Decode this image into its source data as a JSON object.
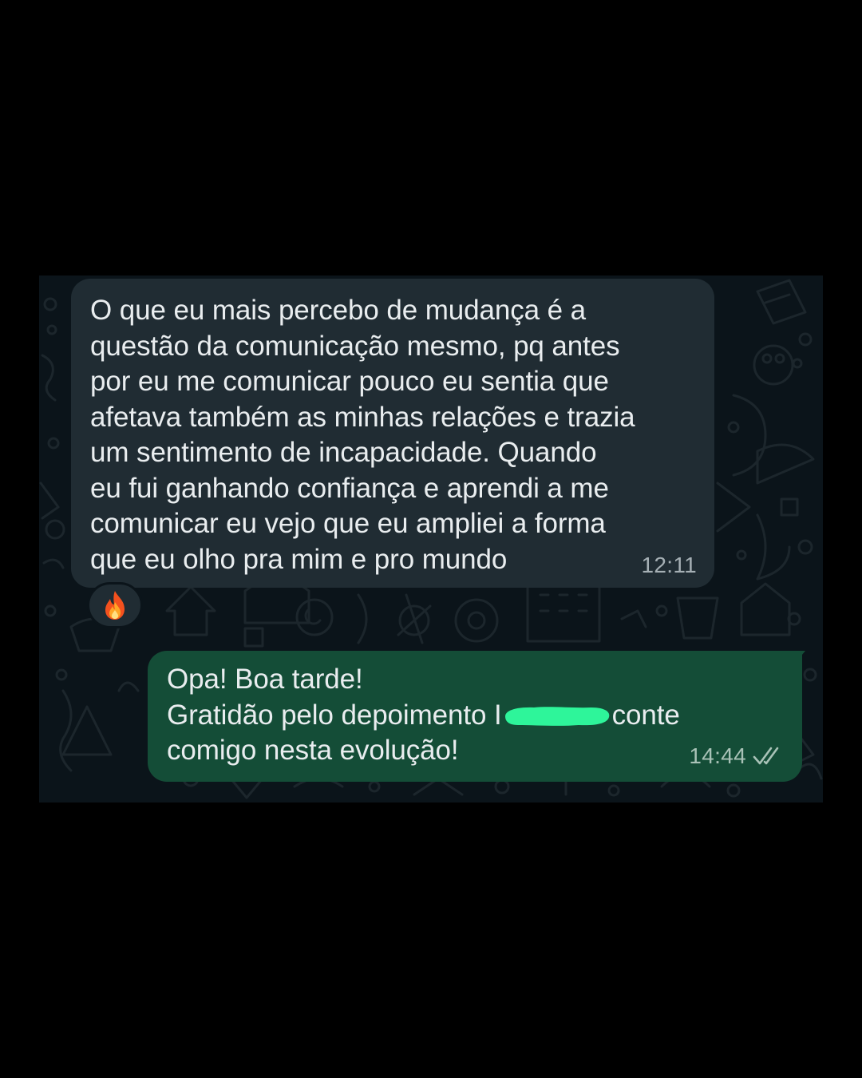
{
  "chat": {
    "incoming": {
      "lines": [
        "O que eu mais percebo de mudança é a",
        "questão da comunicação mesmo, pq antes",
        "por eu me comunicar pouco eu sentia que",
        "afetava também as minhas relações e trazia",
        "um sentimento de incapacidade. Quando",
        "eu fui ganhando confiança e aprendi a me",
        "comunicar eu vejo que eu ampliei a forma",
        "que eu olho pra mim e pro mundo"
      ],
      "time": "12:11",
      "reaction_icon": "fire-emoji-icon"
    },
    "outgoing": {
      "line1": "Opa! Boa tarde!",
      "line2_before": "Gratidão pelo depoimento ",
      "line2_partial": "I",
      "line2_after": "conte",
      "line3": "comigo nesta evolução!",
      "time": "14:44",
      "status_icon": "double-check-read-icon",
      "redaction_color": "#2ef59a"
    }
  },
  "colors": {
    "page_background": "#000000",
    "chat_background": "#0b141a",
    "incoming_bubble": "#202c33",
    "outgoing_bubble": "#144d37",
    "message_text": "#e9edef",
    "timestamp": "#a6b0b5"
  }
}
